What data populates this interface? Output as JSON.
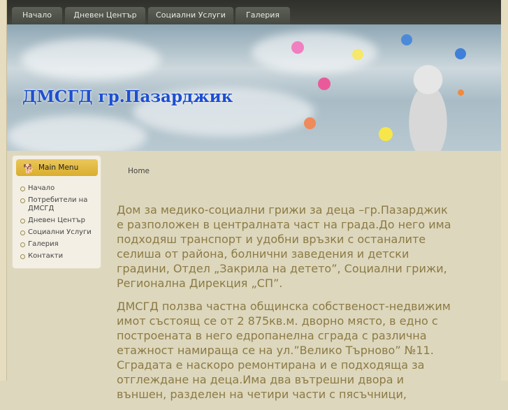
{
  "nav": {
    "tabs": [
      "Начало",
      "Дневен Център",
      "Социални Услуги",
      "Галерия"
    ]
  },
  "header": {
    "title": "ДМСГД гр.Пазарджик"
  },
  "sidebar": {
    "title": "Main Menu",
    "items": [
      "Начало",
      "Потребители на ДМСГД",
      "Дневен Център",
      "Социални Услуги",
      "Галерия",
      "Контакти"
    ]
  },
  "breadcrumb": "Home",
  "content": {
    "paragraphs": [
      "Дом за медико-социални грижи за деца  –гр.Пазарджик е разположен в централната част на града.До него има подходяш транспорт и удобни връзки с останалите селиша от района, болнични заведения и детски градини, Отдел „Закрила на детето”, Социални грижи, Регионална Дирекция „СП”.",
      "ДМСГД ползва частна общинска собственост-недвижим имот състоящ се от 2 875кв.м. дворно място, в едно с построената в него едропанелна сграда с различна етажност намираща се на ул.”Велико Търново” №11. Сградата е наскоро ремонтирана и е подходяща за отглеждане на деца.Има два вътрешни двора и външен, разделен на четири части с пясъчници,"
    ]
  }
}
